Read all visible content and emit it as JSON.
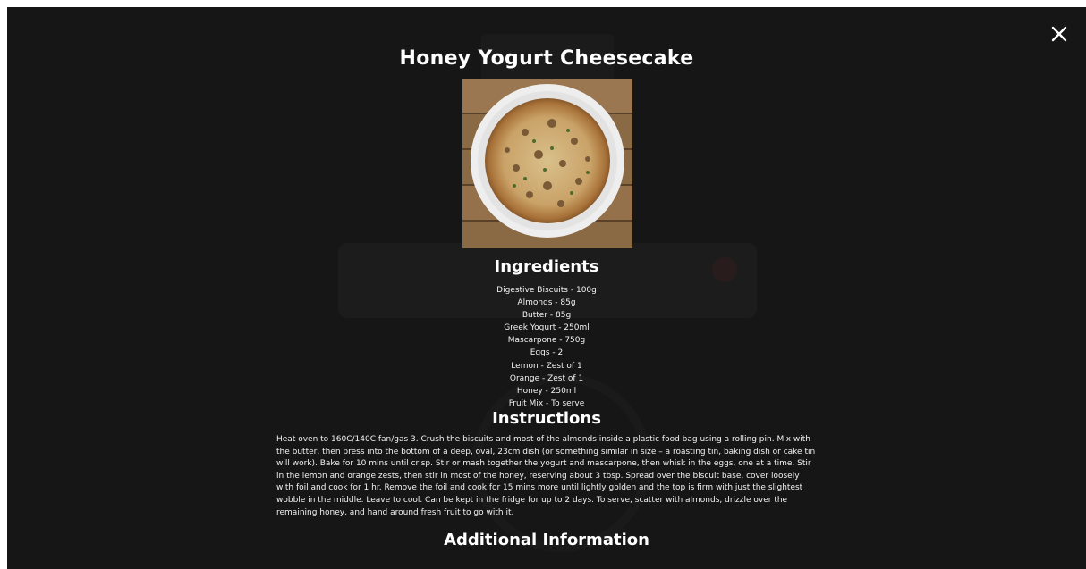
{
  "modal": {
    "title": "Honey Yogurt Cheesecake",
    "close_icon": "close-icon",
    "ingredients_heading": "Ingredients",
    "ingredients": [
      "Digestive Biscuits - 100g",
      "Almonds - 85g",
      "Butter - 85g",
      "Greek Yogurt - 250ml",
      "Mascarpone - 750g",
      "Eggs - 2",
      "Lemon - Zest of 1",
      "Orange - Zest of 1",
      "Honey - 250ml",
      "Fruit Mix - To serve"
    ],
    "instructions_heading": "Instructions",
    "instructions_text": "Heat oven to 160C/140C fan/gas 3. Crush the biscuits and most of the almonds inside a plastic food bag using a rolling pin. Mix with the butter, then press into the bottom of a deep, oval, 23cm dish (or something similar in size – a roasting tin, baking dish or cake tin will work). Bake for 10 mins until crisp. Stir or mash together the yogurt and mascarpone, then whisk in the eggs, one at a time. Stir in the lemon and orange zests, then stir in most of the honey, reserving about 3 tbsp. Spread over the biscuit base, cover loosely with foil and cook for 1 hr. Remove the foil and cook for 15 mins more until lightly golden and the top is firm with just the slightest wobble in the middle. Leave to cool. Can be kept in the fridge for up to 2 days. To serve, scatter with almonds, drizzle over the remaining honey, and hand around fresh fruit to go with it.",
    "additional_heading": "Additional Information"
  },
  "colors": {
    "overlay": "#161616",
    "text": "#ffffff"
  }
}
